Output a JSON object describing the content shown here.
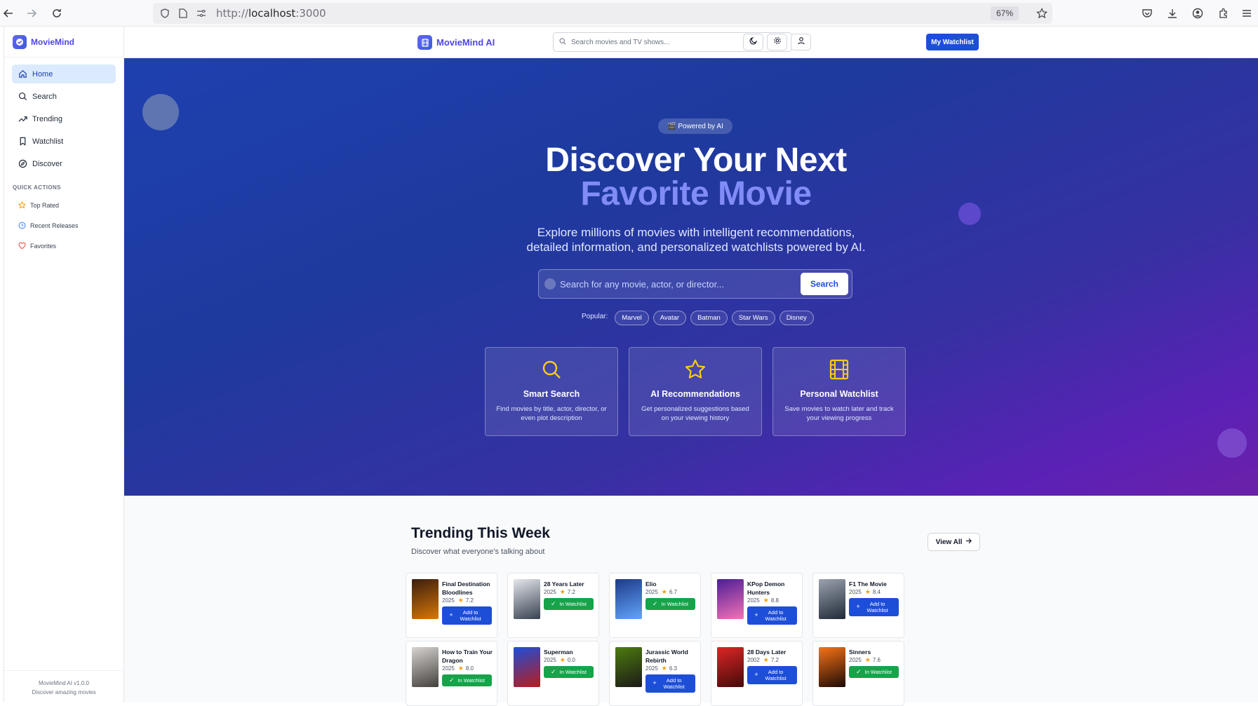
{
  "browser": {
    "url_prefix": "http://",
    "url_host": "localhost",
    "url_port": ":3000",
    "zoom": "67%"
  },
  "sidebar": {
    "brand": "MovieMind",
    "nav": [
      {
        "label": "Home",
        "icon": "home-icon",
        "active": true
      },
      {
        "label": "Search",
        "icon": "search-icon"
      },
      {
        "label": "Trending",
        "icon": "trending-icon"
      },
      {
        "label": "Watchlist",
        "icon": "bookmark-icon"
      },
      {
        "label": "Discover",
        "icon": "compass-icon"
      }
    ],
    "quick_actions_title": "QUICK ACTIONS",
    "quick_actions": [
      {
        "label": "Top Rated",
        "icon": "star-icon",
        "color": "#f59e0b"
      },
      {
        "label": "Recent Releases",
        "icon": "clock-icon",
        "color": "#3b82f6"
      },
      {
        "label": "Favorites",
        "icon": "heart-icon",
        "color": "#ef4444"
      }
    ],
    "footer_version": "MovieMind AI v1.0.0",
    "footer_tagline": "Discover amazing movies"
  },
  "header": {
    "brand": "MovieMind AI",
    "search_placeholder": "Search movies and TV shows...",
    "watchlist_button": "My Watchlist"
  },
  "hero": {
    "badge": "🎬 Powered by AI",
    "title_line1": "Discover Your Next",
    "title_line2": "Favorite Movie",
    "subtitle_line1": "Explore millions of movies with intelligent recommendations,",
    "subtitle_line2": "detailed information, and personalized watchlists powered by AI.",
    "search_placeholder": "Search for any movie, actor, or director...",
    "search_button": "Search",
    "popular_label": "Popular:",
    "popular_tags": [
      "Marvel",
      "Avatar",
      "Batman",
      "Star Wars",
      "Disney"
    ],
    "features": [
      {
        "title": "Smart Search",
        "desc": "Find movies by title, actor, director, or even plot description",
        "icon": "search-icon"
      },
      {
        "title": "AI Recommendations",
        "desc": "Get personalized suggestions based on your viewing history",
        "icon": "star-icon"
      },
      {
        "title": "Personal Watchlist",
        "desc": "Save movies to watch later and track your viewing progress",
        "icon": "film-icon"
      }
    ]
  },
  "trending": {
    "title": "Trending This Week",
    "subtitle": "Discover what everyone's talking about",
    "view_all": "View All",
    "add_label": "Add to Watchlist",
    "in_label": "In Watchlist",
    "movies": [
      {
        "title": "Final Destination Bloodlines",
        "year": "2025",
        "rating": "7.2",
        "in_watchlist": false,
        "poster": [
          "#3b1d0e",
          "#d97706"
        ]
      },
      {
        "title": "28 Years Later",
        "year": "2025",
        "rating": "7.2",
        "in_watchlist": true,
        "poster": [
          "#e5e7eb",
          "#374151"
        ]
      },
      {
        "title": "Elio",
        "year": "2025",
        "rating": "6.7",
        "in_watchlist": true,
        "poster": [
          "#1e3a8a",
          "#60a5fa"
        ]
      },
      {
        "title": "KPop Demon Hunters",
        "year": "2025",
        "rating": "8.8",
        "in_watchlist": false,
        "poster": [
          "#4c1d95",
          "#f472b6"
        ]
      },
      {
        "title": "F1 The Movie",
        "year": "2025",
        "rating": "8.4",
        "in_watchlist": false,
        "poster": [
          "#9ca3af",
          "#1f2937"
        ]
      },
      {
        "title": "How to Train Your Dragon",
        "year": "2025",
        "rating": "8.0",
        "in_watchlist": true,
        "poster": [
          "#d6d3d1",
          "#44403c"
        ]
      },
      {
        "title": "Superman",
        "year": "2025",
        "rating": "0.0",
        "in_watchlist": true,
        "poster": [
          "#1d4ed8",
          "#b91c1c"
        ]
      },
      {
        "title": "Jurassic World Rebirth",
        "year": "2025",
        "rating": "6.3",
        "in_watchlist": false,
        "poster": [
          "#4d7c0f",
          "#1c1917"
        ]
      },
      {
        "title": "28 Days Later",
        "year": "2002",
        "rating": "7.2",
        "in_watchlist": false,
        "poster": [
          "#dc2626",
          "#450a0a"
        ]
      },
      {
        "title": "Sinners",
        "year": "2025",
        "rating": "7.6",
        "in_watchlist": true,
        "poster": [
          "#f97316",
          "#1c0a05"
        ]
      }
    ]
  }
}
